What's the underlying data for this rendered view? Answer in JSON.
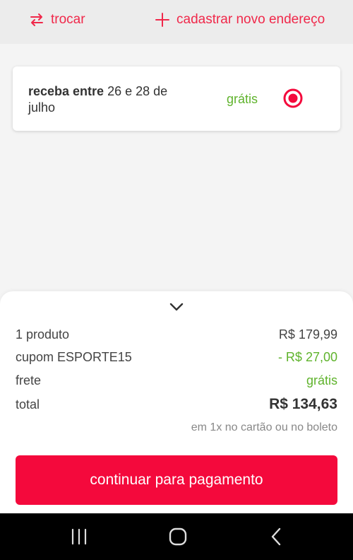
{
  "header": {
    "swap_label": "trocar",
    "add_address_label": "cadastrar novo endereço"
  },
  "delivery": {
    "option_prefix": "receba entre",
    "option_dates": " 26 e 28 de julho",
    "price": "grátis",
    "selected": true
  },
  "summary": {
    "items_label": "1 produto",
    "items_value": "R$ 179,99",
    "coupon_label": "cupom ESPORTE15",
    "coupon_value": "- R$ 27,00",
    "shipping_label": "frete",
    "shipping_value": "grátis",
    "total_label": "total",
    "total_value": "R$ 134,63",
    "payment_note": "em 1x no cartão ou no boleto"
  },
  "actions": {
    "continue_label": "continuar para pagamento"
  },
  "colors": {
    "brand_red": "#f4093c",
    "accent_red": "#f0284a",
    "success_green": "#5fb32c"
  },
  "icons": {
    "swap": "swap-arrows-icon",
    "add": "plus-icon",
    "radio": "radio-selected-icon",
    "collapse": "chevron-down-icon",
    "nav_recents": "recents-icon",
    "nav_home": "home-icon",
    "nav_back": "back-icon"
  }
}
